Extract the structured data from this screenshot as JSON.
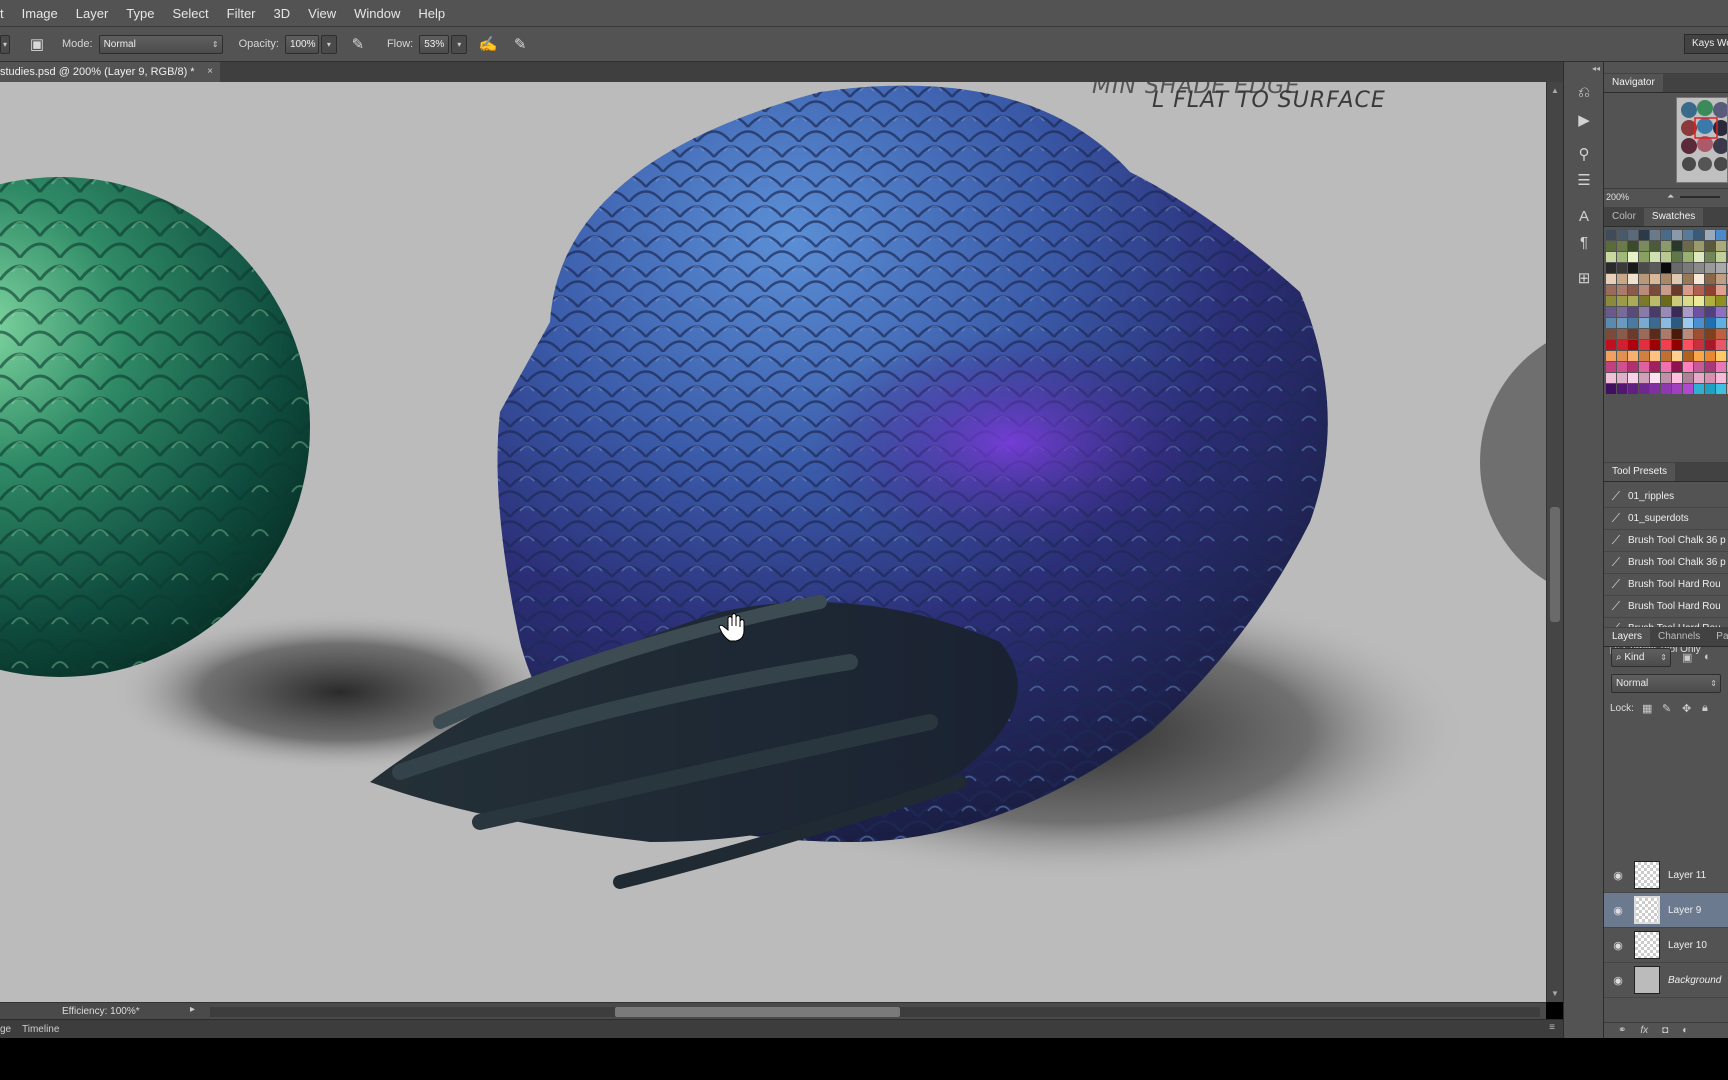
{
  "menu": [
    "t",
    "Image",
    "Layer",
    "Type",
    "Select",
    "Filter",
    "3D",
    "View",
    "Window",
    "Help"
  ],
  "options": {
    "mode_label": "Mode:",
    "mode_value": "Normal",
    "opacity_label": "Opacity:",
    "opacity_value": "100%",
    "flow_label": "Flow:",
    "flow_value": "53%",
    "workspace": "Kays Wo"
  },
  "document": {
    "tab_title": "studies.psd @ 200% (Layer 9, RGB/8) *",
    "close": "×",
    "annotation_line1": "MIN SHADE EDGE",
    "annotation_line2": "L FLAT TO SURFACE"
  },
  "status": {
    "efficiency": "Efficiency: 100%*",
    "timeline_prefix": "ge",
    "timeline": "Timeline"
  },
  "navigator": {
    "tab": "Navigator",
    "zoom": "200%"
  },
  "color_panel": {
    "tabs": [
      "Color",
      "Swatches"
    ],
    "active": "Swatches"
  },
  "tool_presets": {
    "tab": "Tool Presets",
    "items": [
      "01_ripples",
      "01_superdots",
      "Brush Tool Chalk 36 p",
      "Brush Tool Chalk 36 p",
      "Brush Tool Hard Rou",
      "Brush Tool Hard Rou",
      "Brush Tool Hard Rou"
    ],
    "current_tool_only": "Current Tool Only"
  },
  "layers_panel": {
    "tabs": [
      "Layers",
      "Channels",
      "Path"
    ],
    "active": "Layers",
    "kind": "Kind",
    "blend_mode": "Normal",
    "lock_label": "Lock:",
    "layers": [
      {
        "name": "Layer 11",
        "selected": false
      },
      {
        "name": "Layer 9",
        "selected": true
      },
      {
        "name": "Layer 10",
        "selected": false
      },
      {
        "name": "Background",
        "selected": false
      }
    ]
  },
  "colors": {
    "ui_bg": "#535353",
    "canvas_bg": "#bbbbbb",
    "selection": "#6b7a8f"
  }
}
